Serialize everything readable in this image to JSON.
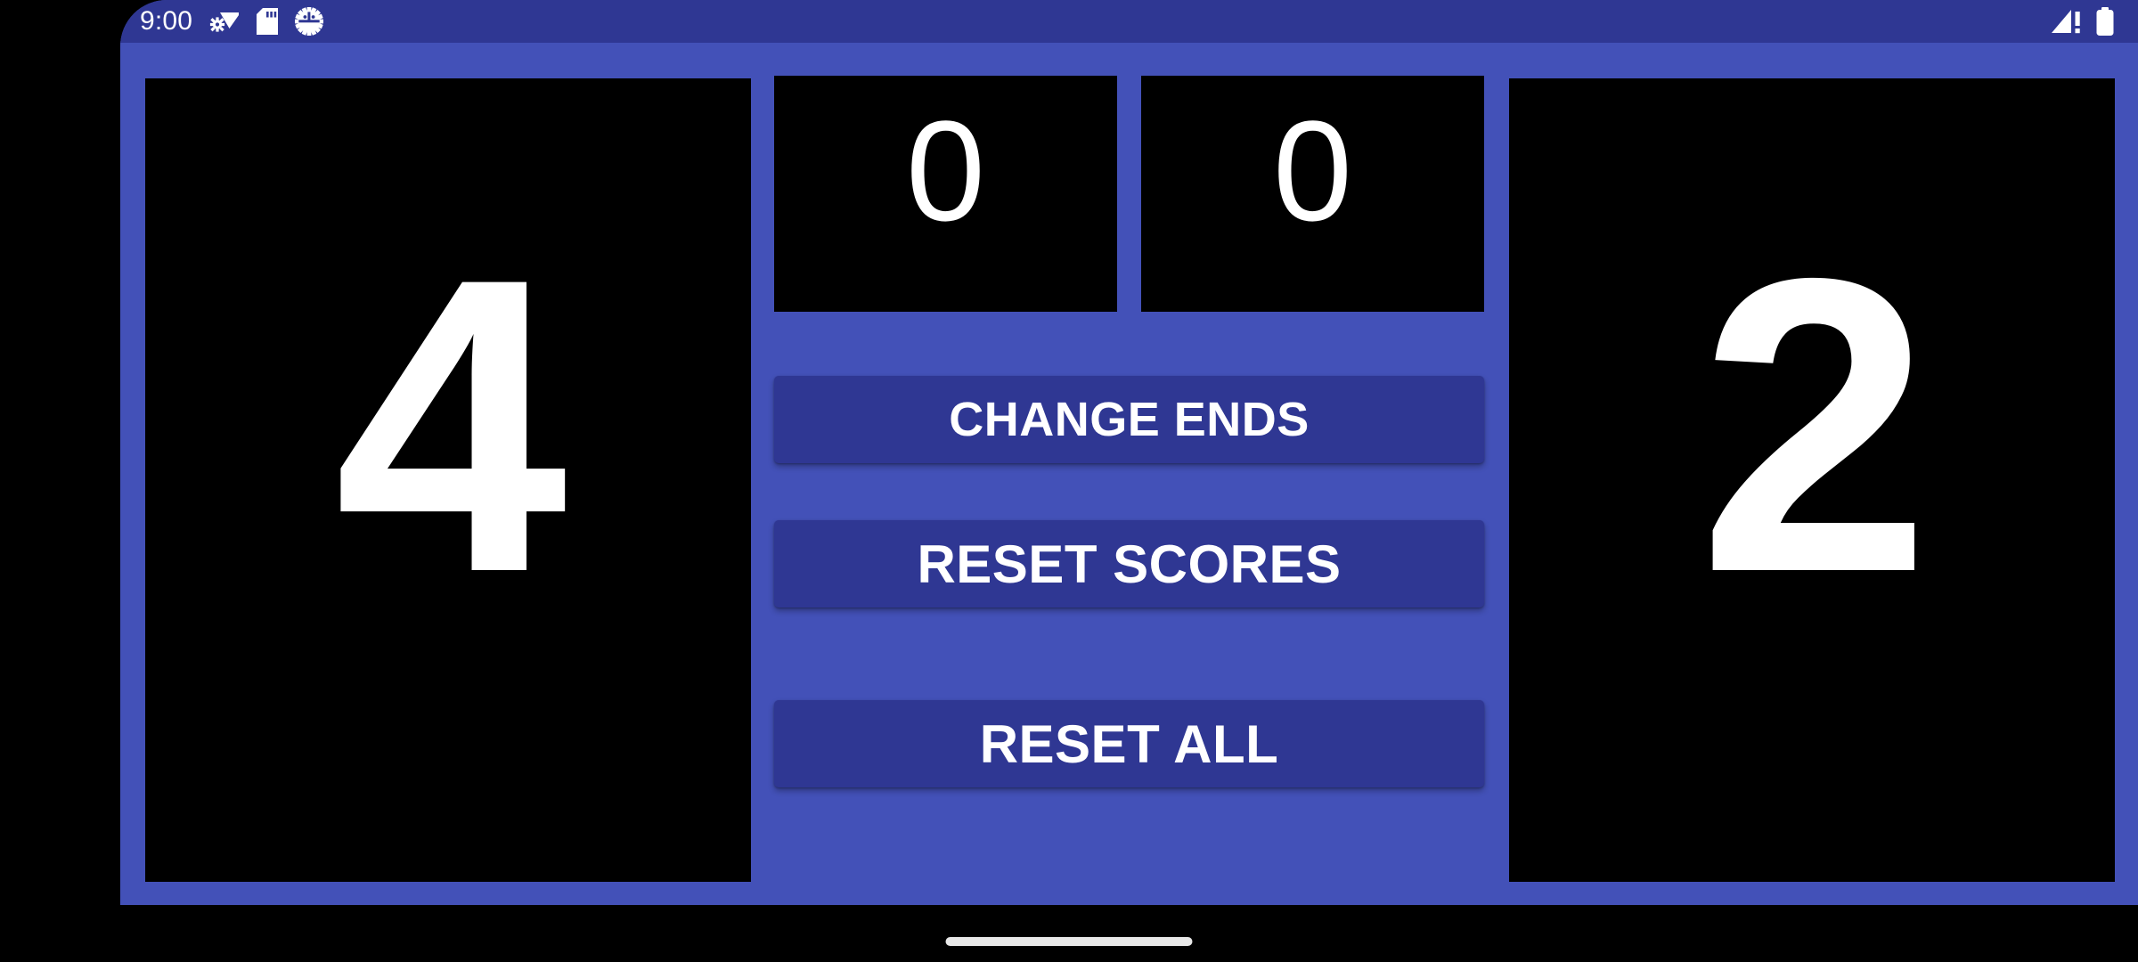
{
  "status_bar": {
    "time": "9:00",
    "left_icons": [
      {
        "name": "wifi-settings-icon",
        "glyph": "wifi-gear"
      },
      {
        "name": "sd-card-icon",
        "glyph": "sd-card"
      },
      {
        "name": "bug-gear-icon",
        "glyph": "bug-gear"
      }
    ],
    "right_icons": [
      {
        "name": "cellular-signal-alert-icon",
        "glyph": "signal-alert"
      },
      {
        "name": "battery-icon",
        "glyph": "battery-full"
      }
    ]
  },
  "scoreboard": {
    "left_player": {
      "label": "left-player-score",
      "score": "4"
    },
    "right_player": {
      "label": "right-player-score",
      "score": "2"
    },
    "sets": {
      "left": "0",
      "right": "0"
    }
  },
  "actions": {
    "change_ends": "CHANGE ENDS",
    "reset_scores": "RESET SCORES",
    "reset_all": "RESET ALL"
  },
  "colors": {
    "app_background": "#4351B8",
    "status_bar": "#2F3793",
    "button": "#2F3793",
    "panel": "#000000",
    "text": "#FFFFFF"
  }
}
